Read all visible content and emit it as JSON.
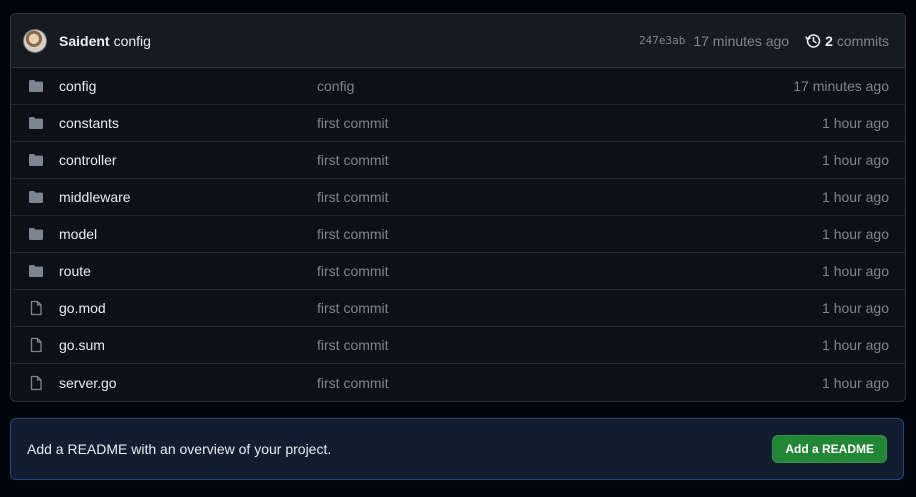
{
  "latest_commit": {
    "author": "Saident",
    "message": "config",
    "sha": "247e3ab",
    "time": "17 minutes ago",
    "commit_count": "2",
    "commits_label": "commits"
  },
  "files": [
    {
      "type": "folder",
      "name": "config",
      "commit": "config",
      "time": "17 minutes ago"
    },
    {
      "type": "folder",
      "name": "constants",
      "commit": "first commit",
      "time": "1 hour ago"
    },
    {
      "type": "folder",
      "name": "controller",
      "commit": "first commit",
      "time": "1 hour ago"
    },
    {
      "type": "folder",
      "name": "middleware",
      "commit": "first commit",
      "time": "1 hour ago"
    },
    {
      "type": "folder",
      "name": "model",
      "commit": "first commit",
      "time": "1 hour ago"
    },
    {
      "type": "folder",
      "name": "route",
      "commit": "first commit",
      "time": "1 hour ago"
    },
    {
      "type": "file",
      "name": "go.mod",
      "commit": "first commit",
      "time": "1 hour ago"
    },
    {
      "type": "file",
      "name": "go.sum",
      "commit": "first commit",
      "time": "1 hour ago"
    },
    {
      "type": "file",
      "name": "server.go",
      "commit": "first commit",
      "time": "1 hour ago"
    }
  ],
  "readme": {
    "text": "Add a README with an overview of your project.",
    "button_label": "Add a README"
  },
  "colors": {
    "background": "#010409",
    "panel": "#0d1117",
    "header": "#161b22",
    "muted_text": "#7d8590",
    "primary_button": "#238636",
    "readme_banner": "#121d2f"
  },
  "icons": {
    "folder": "folder-icon",
    "file": "file-icon",
    "history": "history-icon"
  }
}
